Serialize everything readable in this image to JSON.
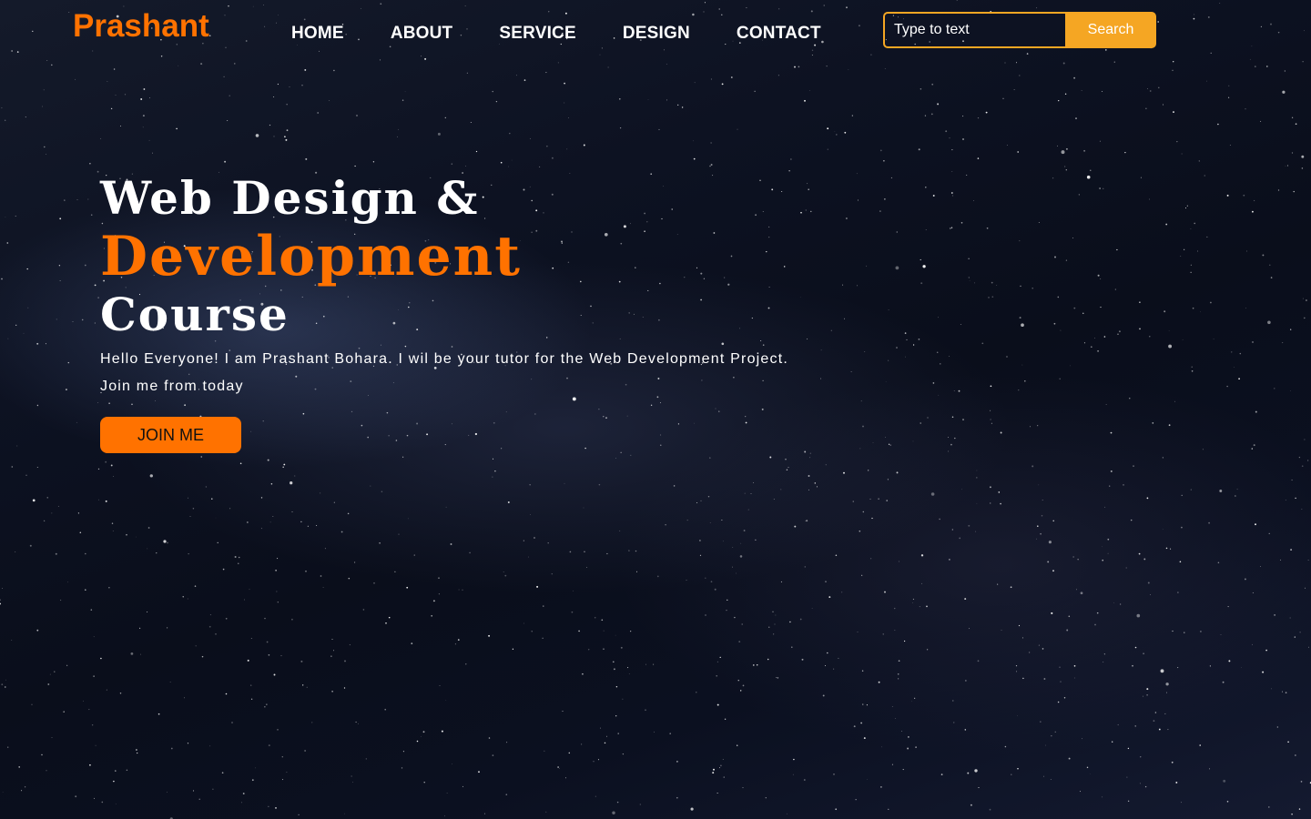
{
  "brand": {
    "logo_text": "Prashant"
  },
  "nav": {
    "items": [
      {
        "label": "HOME"
      },
      {
        "label": "ABOUT"
      },
      {
        "label": "SERVICE"
      },
      {
        "label": "DESIGN"
      },
      {
        "label": "CONTACT"
      }
    ]
  },
  "search": {
    "placeholder": "Type to text",
    "button_label": "Search"
  },
  "hero": {
    "title_line1": "Web Design &",
    "title_line2": "Development",
    "title_line3": "Course",
    "description": "Hello Everyone! I am Prashant Bohara. I wil be your tutor for the Web Development Project. Join me from today",
    "cta_label": "JOIN ME"
  },
  "colors": {
    "accent": "#ff7200",
    "search_accent": "#f5a623",
    "text": "#ffffff",
    "background": "#0b1020"
  }
}
